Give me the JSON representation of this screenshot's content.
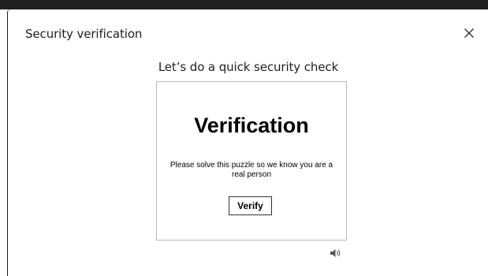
{
  "dialog": {
    "title": "Security verification",
    "close_icon": "close-icon"
  },
  "challenge": {
    "heading": "Let’s do a quick security check",
    "puzzle_title": "Verification",
    "instructions": "Please solve this puzzle so we know you are a real person",
    "verify_label": "Verify",
    "audio_icon": "speaker-icon"
  }
}
